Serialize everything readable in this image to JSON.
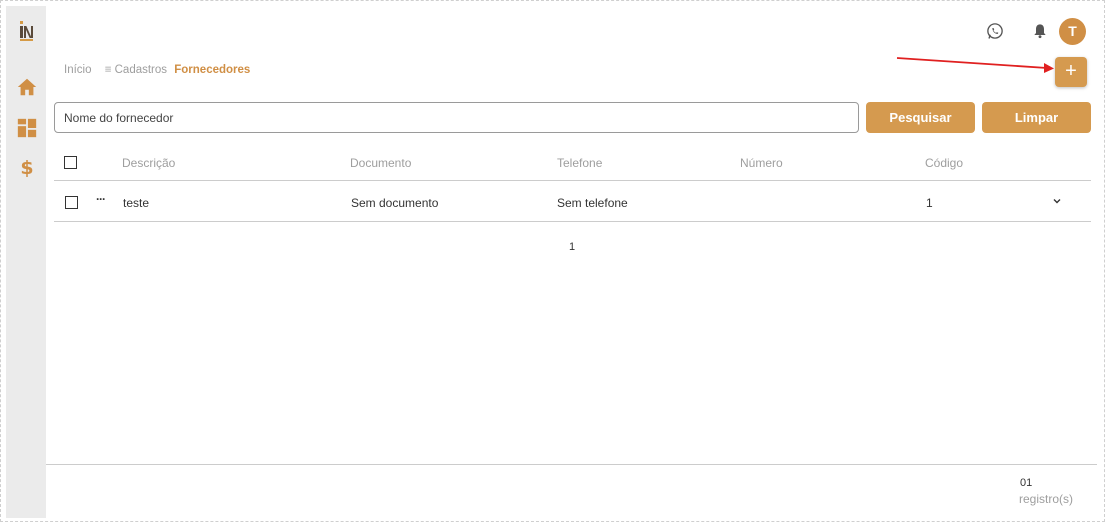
{
  "header": {
    "avatar_initial": "T",
    "icons": [
      "whatsapp-icon",
      "bell-icon"
    ]
  },
  "sidebar": {
    "items": [
      {
        "icon": "home-icon"
      },
      {
        "icon": "dashboard-icon"
      },
      {
        "icon": "dollar-icon",
        "glyph": "$"
      }
    ]
  },
  "breadcrumb": {
    "home": "Início",
    "menu_glyph": "≡",
    "parent": "Cadastros",
    "current": "Fornecedores"
  },
  "toolbar": {
    "add_label": "+"
  },
  "search": {
    "placeholder": "Nome do fornecedor",
    "value": "",
    "search_label": "Pesquisar",
    "clear_label": "Limpar"
  },
  "table": {
    "columns": [
      "Descrição",
      "Documento",
      "Telefone",
      "Número",
      "Código"
    ],
    "rows": [
      {
        "actions_glyph": "···",
        "descricao": "teste",
        "documento": "Sem documento",
        "telefone": "Sem telefone",
        "numero": "",
        "codigo": "1"
      }
    ]
  },
  "pagination": {
    "current_page": "1"
  },
  "footer": {
    "count": "01",
    "label": "registro(s)"
  },
  "colors": {
    "accent": "#d59a4f",
    "brand_dark": "#5a4a3a",
    "sidebar_bg": "#ebebeb",
    "annotation_arrow": "#e02020"
  }
}
